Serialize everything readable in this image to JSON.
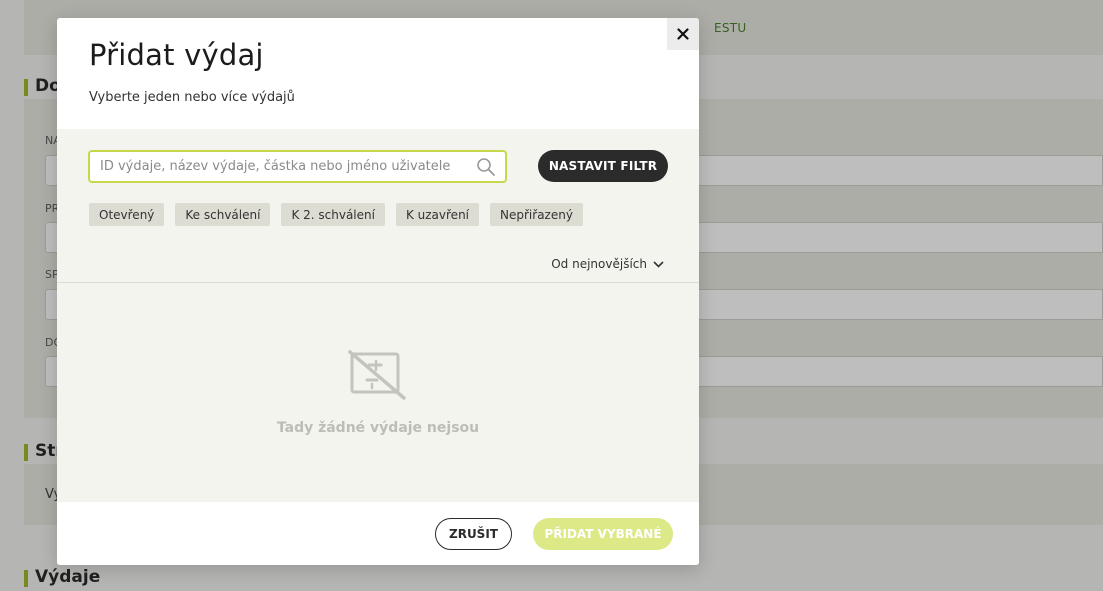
{
  "background": {
    "topbar_link": "ESTU",
    "sections": [
      "Do",
      "Str",
      "Výdaje"
    ],
    "field_labels": [
      "NA",
      "PR",
      "SP",
      "DO"
    ],
    "text_row": "Vy"
  },
  "modal": {
    "title": "Přidat výdaj",
    "subtitle": "Vyberte jeden nebo více výdajů",
    "close_icon": "close-icon",
    "search": {
      "placeholder": "ID výdaje, název výdaje, částka nebo jméno uživatele",
      "value": "",
      "icon": "search-icon"
    },
    "filter_button": "NASTAVIT FILTR",
    "status_chips": [
      "Otevřený",
      "Ke schválení",
      "K 2. schválení",
      "K uzavření",
      "Nepřiřazený"
    ],
    "sort": {
      "label": "Od nejnovějších",
      "icon": "chevron-down-icon"
    },
    "empty_state": {
      "icon": "no-receipt-icon",
      "text": "Tady žádné výdaje nejsou"
    },
    "footer": {
      "cancel_label": "ZRUŠIT",
      "add_label": "PŘIDAT VYBRANÉ"
    }
  },
  "colors": {
    "accent_border": "#c7d84b",
    "accent_disabled": "#dde887",
    "dark_button": "#2b2b2b",
    "section_marker": "#9eb21e"
  }
}
